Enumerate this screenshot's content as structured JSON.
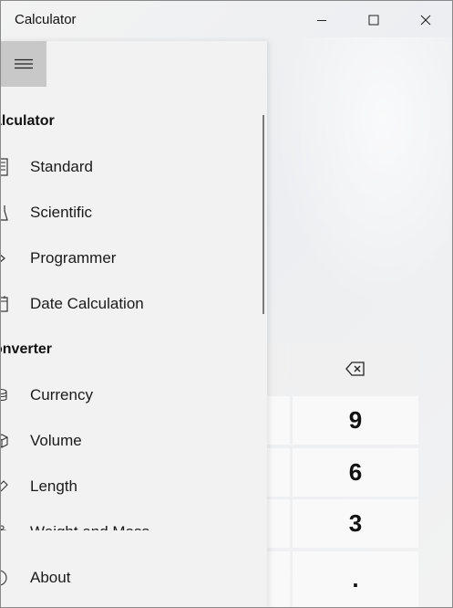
{
  "window": {
    "title": "Calculator"
  },
  "nav": {
    "sections": [
      {
        "header": "alculator",
        "items": [
          {
            "label": "Standard",
            "icon": "calculator-icon"
          },
          {
            "label": "Scientific",
            "icon": "flask-icon"
          },
          {
            "label": "Programmer",
            "icon": "code-icon"
          },
          {
            "label": "Date Calculation",
            "icon": "calendar-icon"
          }
        ]
      },
      {
        "header": "onverter",
        "items": [
          {
            "label": "Currency",
            "icon": "currency-icon"
          },
          {
            "label": "Volume",
            "icon": "cube-icon"
          },
          {
            "label": "Length",
            "icon": "ruler-icon"
          },
          {
            "label": "Weight and Mass",
            "icon": "weight-icon"
          }
        ]
      }
    ],
    "about": {
      "label": "About",
      "icon": "info-icon"
    }
  },
  "keypad": {
    "backspace": "backspace-icon",
    "keys": [
      "9",
      "6",
      "3",
      "."
    ]
  }
}
